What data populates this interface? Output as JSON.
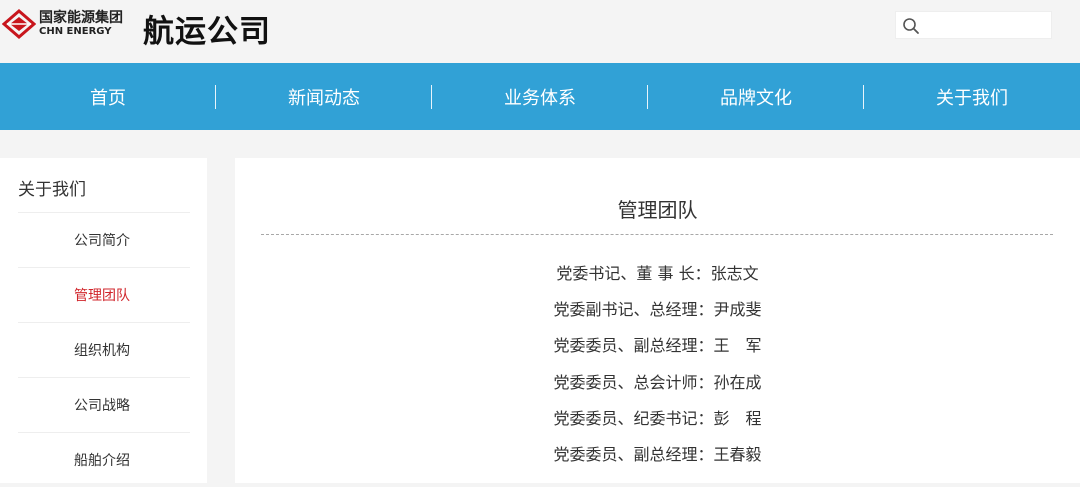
{
  "header": {
    "logo_cn": "国家能源集团",
    "logo_en": "CHN ENERGY",
    "brand": "航运公司",
    "search": {
      "placeholder": "",
      "value": ""
    }
  },
  "nav": [
    {
      "label": "首页"
    },
    {
      "label": "新闻动态"
    },
    {
      "label": "业务体系"
    },
    {
      "label": "品牌文化"
    },
    {
      "label": "关于我们"
    }
  ],
  "sidebar": {
    "title": "关于我们",
    "items": [
      {
        "label": "公司简介",
        "active": false
      },
      {
        "label": "管理团队",
        "active": true
      },
      {
        "label": "组织机构",
        "active": false
      },
      {
        "label": "公司战略",
        "active": false
      },
      {
        "label": "船舶介绍",
        "active": false
      }
    ]
  },
  "content": {
    "title": "管理团队",
    "members": [
      "党委书记、董 事 长：张志文",
      "党委副书记、总经理：尹成斐",
      "党委委员、副总经理：王　军",
      "党委委员、总会计师：孙在成",
      "党委委员、纪委书记：彭　程",
      "党委委员、副总经理：王春毅"
    ]
  },
  "colors": {
    "nav_bg": "#31a1d6",
    "active_text": "#d0252b",
    "logo_red": "#c8161d"
  }
}
